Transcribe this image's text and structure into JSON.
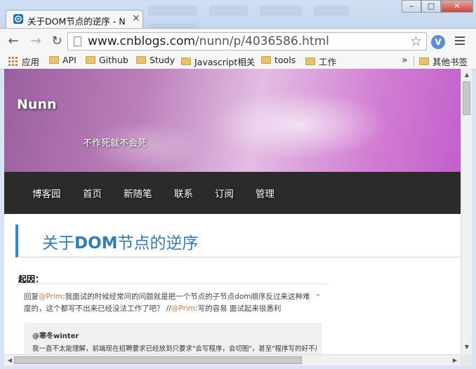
{
  "window": {
    "controls": {
      "minimize": "‒",
      "maximize": "□",
      "close": "✕"
    }
  },
  "tab": {
    "title": "关于DOM节点的逆序 - N",
    "close": "×",
    "favicon": "cnblogs-icon"
  },
  "toolbar": {
    "back": "←",
    "forward": "→",
    "reload": "↻",
    "url_host": "www.cnblogs.com",
    "url_path": "/nunn/p/4036586.html",
    "star": "☆",
    "ext": "V"
  },
  "bookmarks": {
    "apps": "应用",
    "items": [
      "API",
      "Github",
      "Study",
      "Javascript相关",
      "tools",
      "工作"
    ],
    "more": "»",
    "other": "其他书签"
  },
  "page": {
    "blog_title": "Nunn",
    "blog_subtitle": "不作死就不会死",
    "nav": [
      "博客园",
      "首页",
      "新随笔",
      "联系",
      "订阅",
      "管理"
    ],
    "post_title_prefix": "关于",
    "post_title_bold": "DOM",
    "post_title_suffix": "节点的逆序",
    "section_label": "起因：",
    "comment": {
      "reply": "回复",
      "mention1": "@Prim",
      "text1": ":我面试的时候经常问的问题就是把一个节点的子节点dom顺序反过来这种难度的，这个都写不出来已经没法工作了吧？ //",
      "mention2": "@Prim",
      "text2": ":写的容易 面试起来很愚利"
    },
    "quote": {
      "author": "@寒冬winter",
      "text": "我一直不太能理解，前端现在招聘要求已经放到只要求\"会写程序，会切图\"，甚至\"程序写的好不用会"
    }
  }
}
